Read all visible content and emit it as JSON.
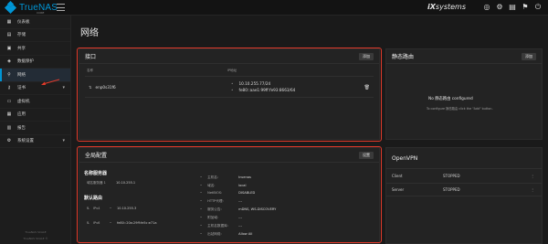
{
  "header": {
    "logo_text": "TrueNAS",
    "logo_sub": "CORE",
    "brand_ix": "iX",
    "brand_rest": "systems",
    "icons": [
      "truecommand-icon",
      "settings-icon",
      "tasks-icon",
      "alert-icon",
      "power-icon"
    ],
    "icon_glyphs": [
      "◎",
      "⚙",
      "▤",
      "⚑",
      "⏻"
    ]
  },
  "sidebar": {
    "items": [
      {
        "label": "仪表板",
        "icon": "dashboard-icon",
        "glyph": "▦"
      },
      {
        "label": "存储",
        "icon": "storage-icon",
        "glyph": "▤"
      },
      {
        "label": "共享",
        "icon": "shares-icon",
        "glyph": "▣"
      },
      {
        "label": "数据保护",
        "icon": "shield-icon",
        "glyph": "◈"
      },
      {
        "label": "网络",
        "icon": "network-icon",
        "glyph": "⚲"
      },
      {
        "label": "证书",
        "icon": "key-icon",
        "glyph": "⚷"
      },
      {
        "label": "虚拟机",
        "icon": "vm-icon",
        "glyph": "▭"
      },
      {
        "label": "应用",
        "icon": "apps-icon",
        "glyph": "▦"
      },
      {
        "label": "报告",
        "icon": "reporting-icon",
        "glyph": "▥"
      },
      {
        "label": "系统设置",
        "icon": "gear-icon",
        "glyph": "⚙"
      }
    ],
    "footer1": "TrueNAS SCALE",
    "footer2": "TrueNAS SCALE ©"
  },
  "page": {
    "title": "网络"
  },
  "interfaces": {
    "title": "接口",
    "add_label": "添加",
    "col_name": "名称",
    "col_ip": "IP地址",
    "rows": [
      {
        "name": "enp0s31f6",
        "ip1": "10.10.255.77/24",
        "ip2": "fe80::aae1:99ff:fe93:8663/64"
      }
    ]
  },
  "static_routes": {
    "title": "静态路由",
    "add_label": "添加",
    "empty_title": "No 静态路由 configured",
    "empty_hint": "To configure 静态路由 click the \"Add\" button."
  },
  "global_config": {
    "title": "全局配置",
    "settings_label": "设置",
    "nameservers_title": "名称服务器",
    "nameserver_label": "域名服务器 1",
    "nameserver_value": "10.10.255.1",
    "gateway_title": "默认路由",
    "ipv4_label": "IPv4",
    "ipv4_value": "10.10.255.3",
    "ipv6_label": "IPv6",
    "ipv6_value": "fe80::20a:29ff:fe5c:e71a",
    "fields": [
      {
        "k": "主机名:",
        "v": "truenas"
      },
      {
        "k": "域名:",
        "v": "local"
      },
      {
        "k": "NetBIOS:",
        "v": "DISABLED"
      },
      {
        "k": "HTTP代理:",
        "v": "---"
      },
      {
        "k": "服务公告:",
        "v": "mDNS, WS-DISCOVERY"
      },
      {
        "k": "附加域:",
        "v": "---"
      },
      {
        "k": "主机名数据库:",
        "v": "---"
      },
      {
        "k": "出站网络:",
        "v": "Allow All"
      }
    ]
  },
  "openvpn": {
    "title": "OpenVPN",
    "rows": [
      {
        "k": "Client",
        "v": "STOPPED"
      },
      {
        "k": "Server",
        "v": "STOPPED"
      }
    ]
  },
  "colors": {
    "accent": "#0095d5",
    "highlight": "#e23a2a",
    "background": "#1a1a1a",
    "card": "#232323"
  }
}
